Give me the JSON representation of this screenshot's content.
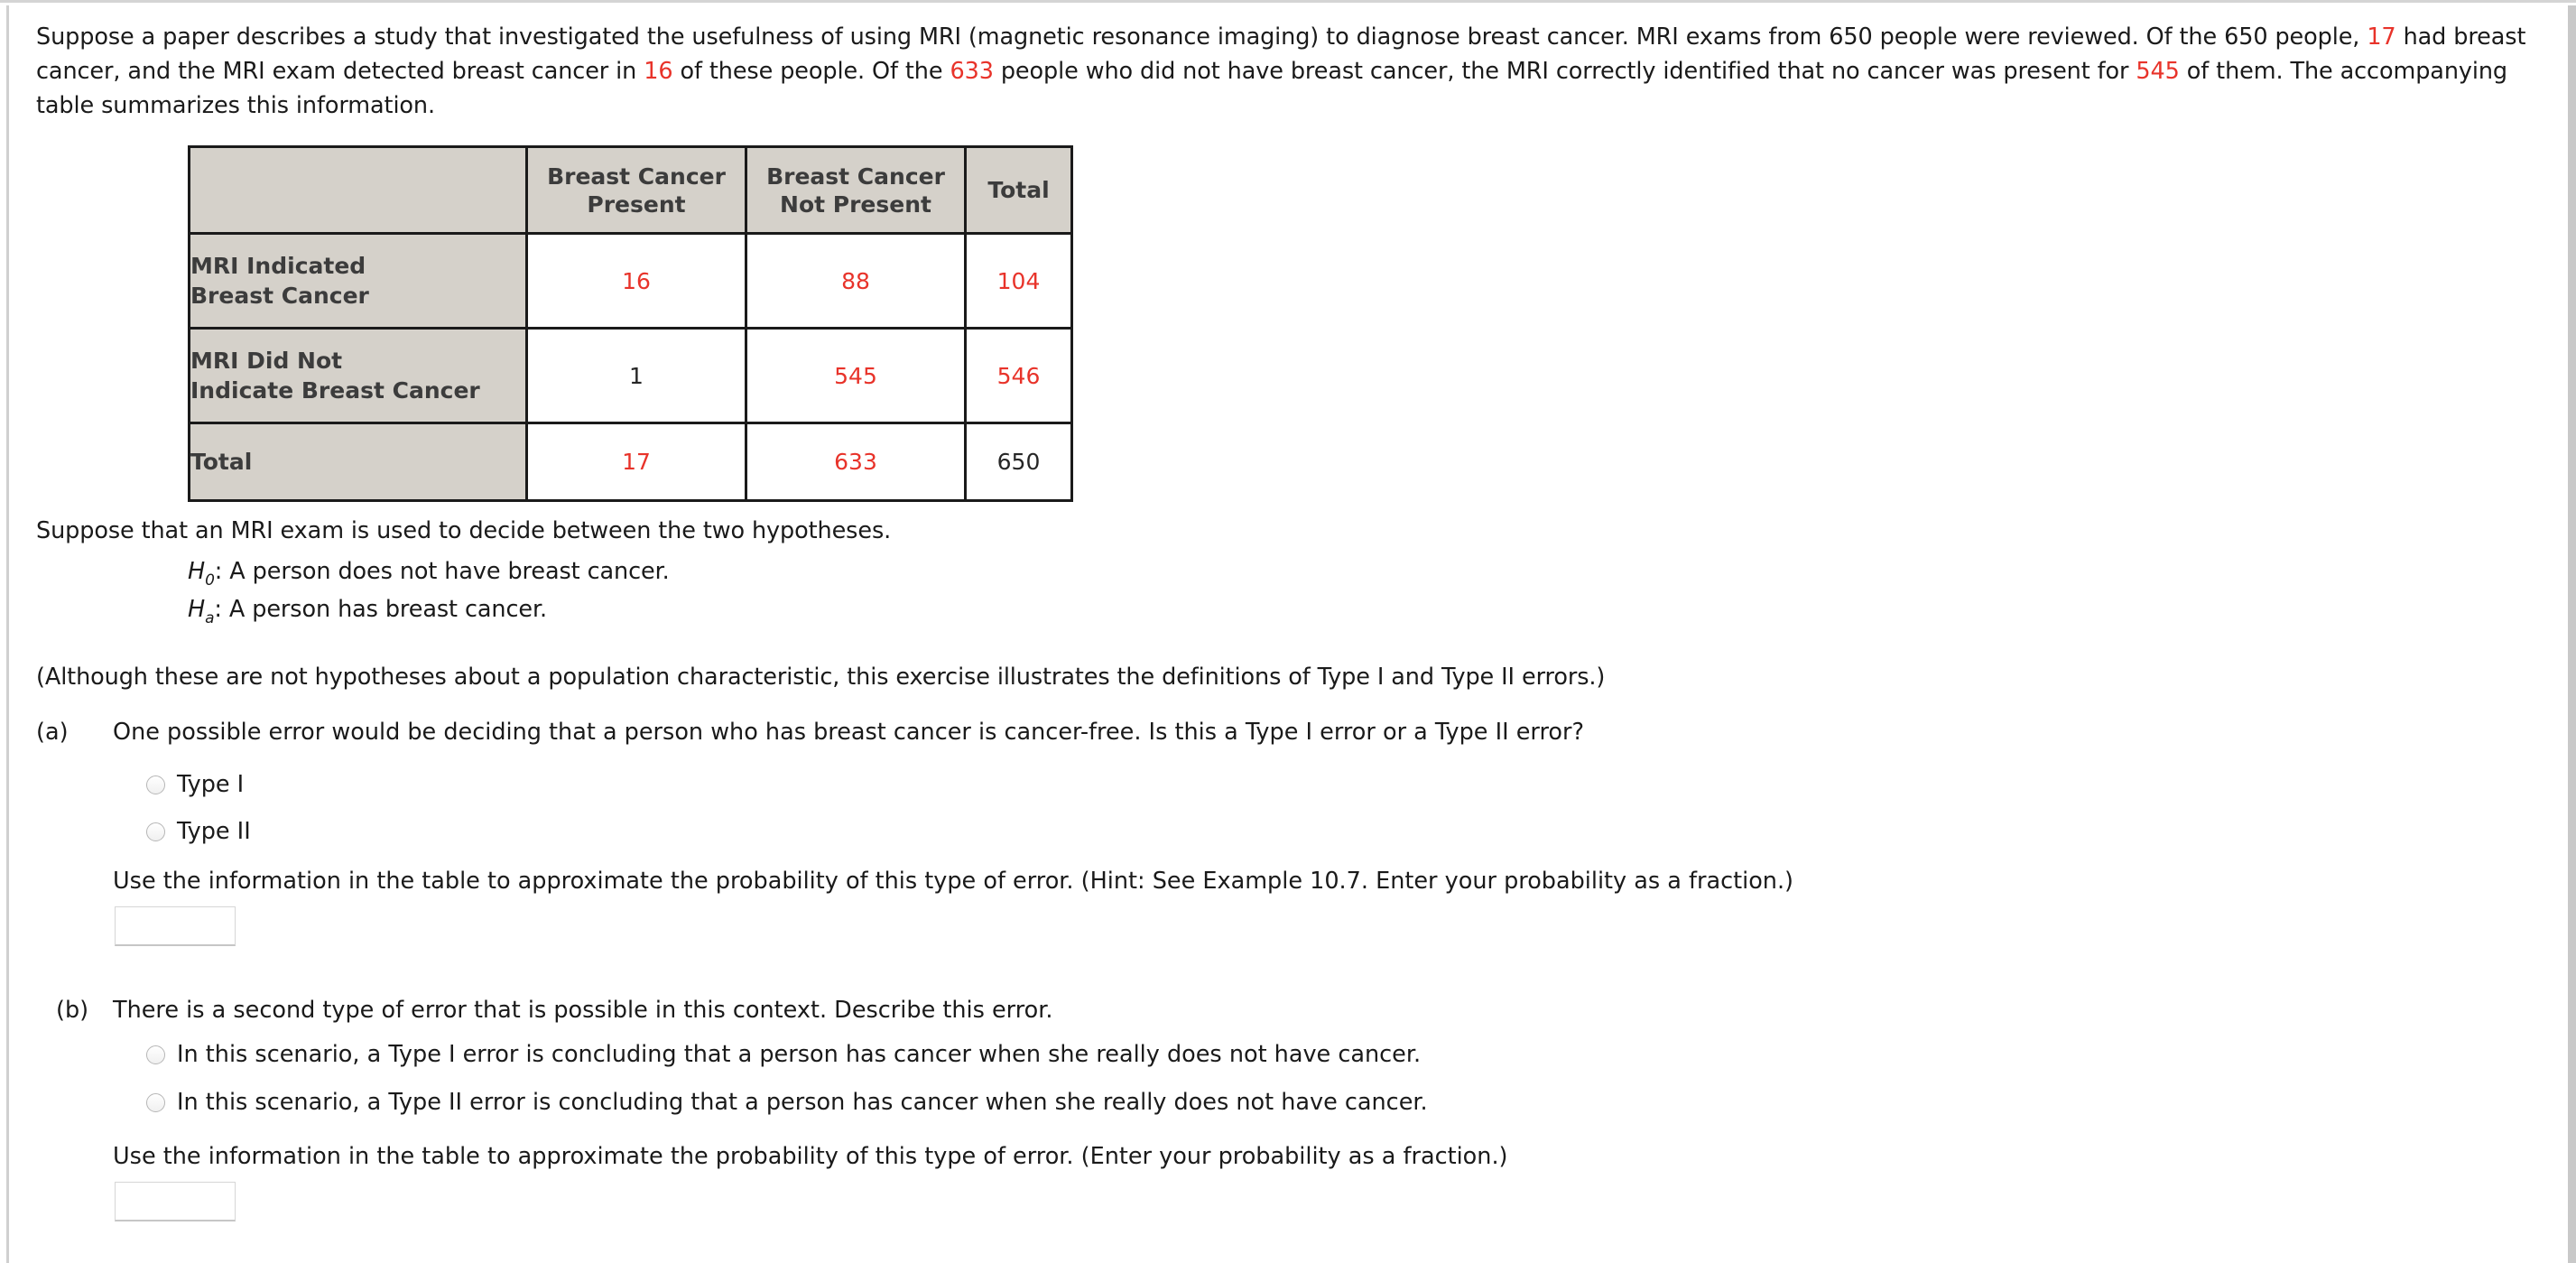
{
  "problem": {
    "intro_segments": [
      {
        "text": "Suppose a paper describes a study that investigated the usefulness of using MRI (magnetic resonance imaging) to diagnose breast cancer. MRI exams from 650 people were reviewed. Of the 650 people, ",
        "color": "black"
      },
      {
        "text": "17",
        "color": "red"
      },
      {
        "text": " had breast cancer, and the MRI exam detected breast cancer in ",
        "color": "black"
      },
      {
        "text": "16",
        "color": "red"
      },
      {
        "text": " of these people. Of the ",
        "color": "black"
      },
      {
        "text": "633",
        "color": "red"
      },
      {
        "text": " people who did not have breast cancer, the MRI correctly identified that no cancer was present for ",
        "color": "black"
      },
      {
        "text": "545",
        "color": "red"
      },
      {
        "text": " of them. The accompanying table summarizes this information.",
        "color": "black"
      }
    ],
    "intro_full": "Suppose a paper describes a study that investigated the usefulness of using MRI (magnetic resonance imaging) to diagnose breast cancer. MRI exams from 650 people were reviewed. Of the 650 people, 17 had breast cancer, and the MRI exam detected breast cancer in 16 of these people. Of the 633 people who did not have breast cancer, the MRI correctly identified that no cancer was present for 545 of them. The accompanying table summarizes this information."
  },
  "table": {
    "corner_label": "",
    "column_headers": [
      "Breast Cancer Present",
      "Breast Cancer Not Present",
      "Total"
    ],
    "column_headers_lines": [
      [
        "Breast Cancer",
        "Present"
      ],
      [
        "Breast Cancer",
        "Not Present"
      ],
      [
        "Total"
      ]
    ],
    "rows": [
      {
        "label_lines": [
          "MRI Indicated",
          "Breast Cancer"
        ],
        "cells": [
          {
            "value": "16",
            "color": "red"
          },
          {
            "value": "88",
            "color": "red"
          },
          {
            "value": "104",
            "color": "red"
          }
        ]
      },
      {
        "label_lines": [
          "MRI Did Not",
          "Indicate Breast Cancer"
        ],
        "cells": [
          {
            "value": "1",
            "color": "black"
          },
          {
            "value": "545",
            "color": "red"
          },
          {
            "value": "546",
            "color": "red"
          }
        ]
      },
      {
        "label_lines": [
          "Total"
        ],
        "cells": [
          {
            "value": "17",
            "color": "red"
          },
          {
            "value": "633",
            "color": "red"
          },
          {
            "value": "650",
            "color": "black"
          }
        ]
      }
    ]
  },
  "hypotheses": {
    "lead_in": "Suppose that an MRI exam is used to decide between the two hypotheses.",
    "null_symbol": "H",
    "null_subscript": "0",
    "null_text": ": A person does not have breast cancer.",
    "alt_symbol": "H",
    "alt_subscript": "a",
    "alt_text": ": A person has breast cancer.",
    "note": "(Although these are not hypotheses about a population characteristic, this exercise illustrates the definitions of Type I and Type II errors.)"
  },
  "parts": [
    {
      "label": "(a)",
      "question": "One possible error would be deciding that a person who has breast cancer is cancer-free. Is this a Type I error or a Type II error?",
      "choices": [
        "Type I",
        "Type II"
      ],
      "selected": null,
      "prompt": "Use the information in the table to approximate the probability of this type of error. (Hint: See Example 10.7. Enter your probability as a fraction.)",
      "answer_value": "",
      "answer_placeholder": ""
    },
    {
      "label": "(b)",
      "question": "There is a second type of error that is possible in this context. Describe this error.",
      "choices": [
        "In this scenario, a Type I error is concluding that a person has cancer when she really does not have cancer.",
        "In this scenario, a Type II error is concluding that a person has cancer when she really does not have cancer."
      ],
      "selected": null,
      "prompt": "Use the information in the table to approximate the probability of this type of error. (Enter your probability as a fraction.)",
      "answer_value": "",
      "answer_placeholder": ""
    }
  ],
  "colors": {
    "highlight_red": "#e8332a",
    "table_header_bg": "#d5d1ca",
    "table_border": "#1a1a1a",
    "table_text": "#3c3c3c"
  }
}
